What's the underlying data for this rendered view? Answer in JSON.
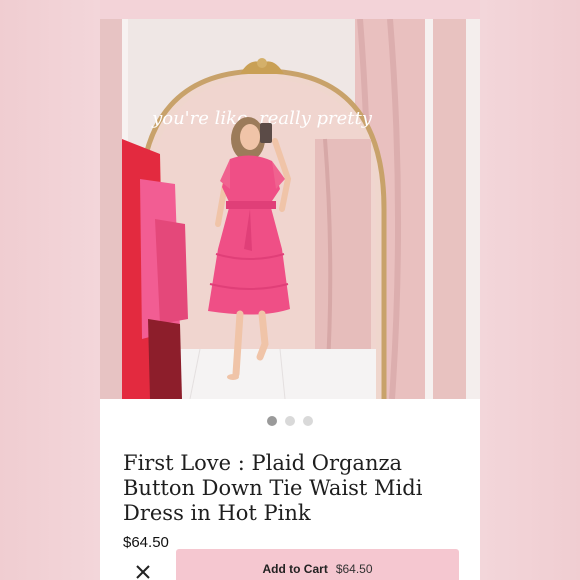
{
  "product": {
    "title": "First Love : Plaid Organza Button Down Tie Waist Midi Dress in Hot Pink",
    "price": "$64.50"
  },
  "photo": {
    "mirror_text": "you're like, really pretty",
    "dress_color": "#ef4f86"
  },
  "carousel": {
    "count": 3,
    "active_index": 0
  },
  "actions": {
    "close_icon": "close-icon",
    "add_to_cart_label": "Add to Cart",
    "add_to_cart_price": "$64.50"
  },
  "colors": {
    "accent": "#f5c7d0",
    "background": "#f1d2d6"
  }
}
